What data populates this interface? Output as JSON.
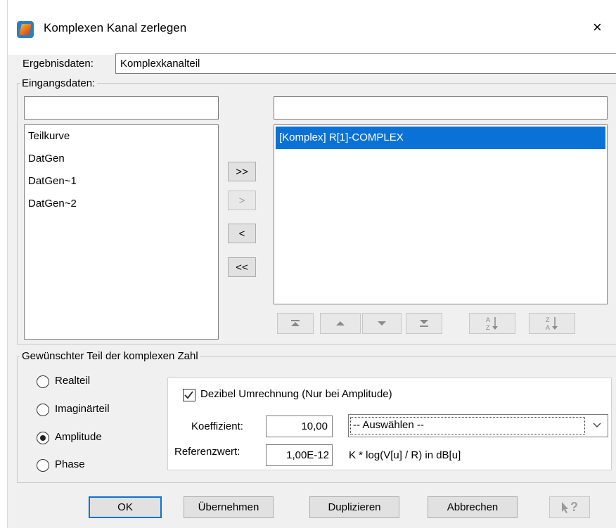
{
  "window": {
    "title": "Komplexen Kanal zerlegen",
    "close_glyph": "×"
  },
  "result": {
    "label": "Ergebnisdaten:",
    "value": "Komplexkanalteil"
  },
  "input_group": {
    "title": "Eingangsdaten:",
    "left_filter_value": "",
    "right_filter_value": "",
    "available_items": [
      "Teilkurve",
      "DatGen",
      "DatGen~1",
      "DatGen~2"
    ],
    "selected_items": [
      "[Komplex] R[1]-COMPLEX"
    ],
    "buttons": {
      "add_all": ">>",
      "add": ">",
      "remove": "<",
      "remove_all": "<<"
    }
  },
  "part_group": {
    "title": "Gewünschter Teil der komplexen Zahl",
    "options": [
      {
        "label": "Realteil",
        "checked": false
      },
      {
        "label": "Imaginärteil",
        "checked": false
      },
      {
        "label": "Amplitude",
        "checked": true
      },
      {
        "label": "Phase",
        "checked": false
      }
    ],
    "decibel": {
      "checkbox_label": "Dezibel Umrechnung (Nur bei Amplitude)",
      "checked": true,
      "coefficient_label": "Koeffizient:",
      "coefficient_value": "10,00",
      "reference_label": "Referenzwert:",
      "reference_value": "1,00E-12",
      "preset_selected": "-- Auswählen --",
      "formula": "K * log(V[u] / R) in dB[u]"
    }
  },
  "footer": {
    "ok": "OK",
    "apply": "Übernehmen",
    "duplicate": "Duplizieren",
    "cancel": "Abbrechen",
    "help_glyph": "?"
  },
  "colors": {
    "selection": "#0a72d6",
    "default_button_border": "#0a72d6"
  },
  "icons": [
    "app-icon",
    "close-icon",
    "move-top-icon",
    "move-up-icon",
    "move-down-icon",
    "move-bottom-icon",
    "sort-ascending-icon",
    "sort-descending-icon",
    "chevron-down-icon",
    "help-pointer-icon"
  ]
}
